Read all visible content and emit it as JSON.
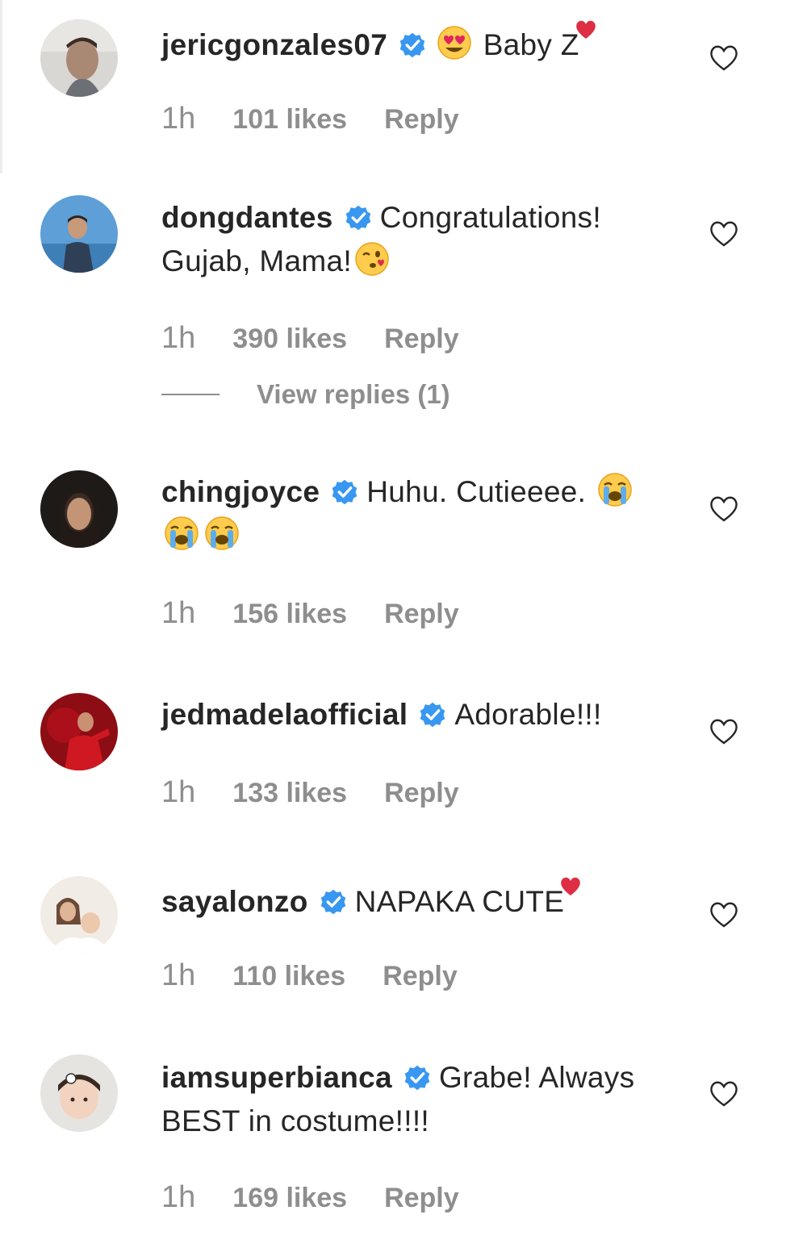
{
  "comments": [
    {
      "username": "jericgonzales07",
      "text_parts": [
        "Baby Z"
      ],
      "time": "1h",
      "likes": "101 likes",
      "reply": "Reply"
    },
    {
      "username": "dongdantes",
      "text_line1": "Congratulations!",
      "text_line2": "Gujab, Mama!",
      "time": "1h",
      "likes": "390 likes",
      "reply": "Reply",
      "view_replies": "View replies (1)"
    },
    {
      "username": "chingjoyce",
      "text": "Huhu. Cutieeee.",
      "time": "1h",
      "likes": "156 likes",
      "reply": "Reply"
    },
    {
      "username": "jedmadelaofficial",
      "text": "Adorable!!!",
      "time": "1h",
      "likes": "133 likes",
      "reply": "Reply"
    },
    {
      "username": "sayalonzo",
      "text": "NAPAKA CUTE",
      "time": "1h",
      "likes": "110 likes",
      "reply": "Reply"
    },
    {
      "username": "iamsuperbianca",
      "text_line1": "Grabe! Always",
      "text_line2": "BEST in costume!!!!",
      "time": "1h",
      "likes": "169 likes",
      "reply": "Reply"
    }
  ],
  "icons": {
    "verified": "verified-badge-icon",
    "like": "heart-outline-icon",
    "emoji_heart_eyes": "heart-eyes-emoji-icon",
    "emoji_kiss_wink": "kissing-wink-emoji-icon",
    "emoji_crying": "loudly-crying-emoji-icon",
    "emoji_red_heart": "red-heart-emoji-icon"
  },
  "colors": {
    "username": "#262626",
    "meta": "#8e8e8e",
    "verified": "#3897f0",
    "heart_red": "#e0245e",
    "emoji_yellow": "#ffcc4d"
  }
}
